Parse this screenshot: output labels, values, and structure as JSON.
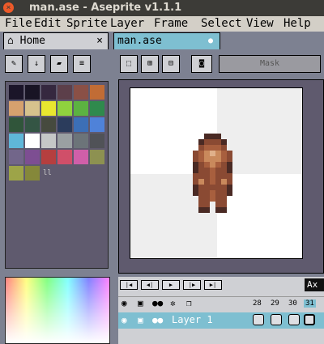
{
  "window": {
    "title": "man.ase - Aseprite v1.1.1",
    "close_glyph": "×",
    "minimize_glyph": "–",
    "maximize_glyph": "□"
  },
  "menu": [
    "File",
    "Edit",
    "Sprite",
    "Layer",
    "Frame",
    "Select",
    "View",
    "Help"
  ],
  "tabs": {
    "home_label": "Home",
    "home_close": "×",
    "file_label": "man.ase",
    "file_modified": "●"
  },
  "toolbar": {
    "mask_label": "Mask"
  },
  "palette": {
    "colors": [
      "#1b1529",
      "#181424",
      "#35283f",
      "#5c3f4a",
      "#8a5046",
      "#c16c35",
      "#d6a16e",
      "#d7c28d",
      "#e9e62f",
      "#8fd23e",
      "#5cb241",
      "#2f8a4d",
      "#30553a",
      "#345544",
      "#464a3e",
      "#2b3c5c",
      "#3c6fb6",
      "#4f82d9",
      "#5fb7d9",
      "#ffffff",
      "#c5c7c7",
      "#9aa0a2",
      "#6c7479",
      "#505257",
      "#72668a",
      "#7d4e92",
      "#b53f3f",
      "#d04f69",
      "#d05fa9",
      "#8d9151",
      "#9da448",
      "#85883a"
    ],
    "more_glyph": "ll"
  },
  "timeline": {
    "nav_buttons": [
      "|◀",
      "◀|",
      "▶",
      "|▶",
      "▶|"
    ],
    "frame_numbers": [
      "28",
      "29",
      "30",
      "31"
    ],
    "active_frame": "31",
    "tooltip": "Ax",
    "layer_name": "Layer 1",
    "layer_icons": {
      "eye": "👁",
      "lock": "🔒",
      "continuous": "●●"
    }
  }
}
